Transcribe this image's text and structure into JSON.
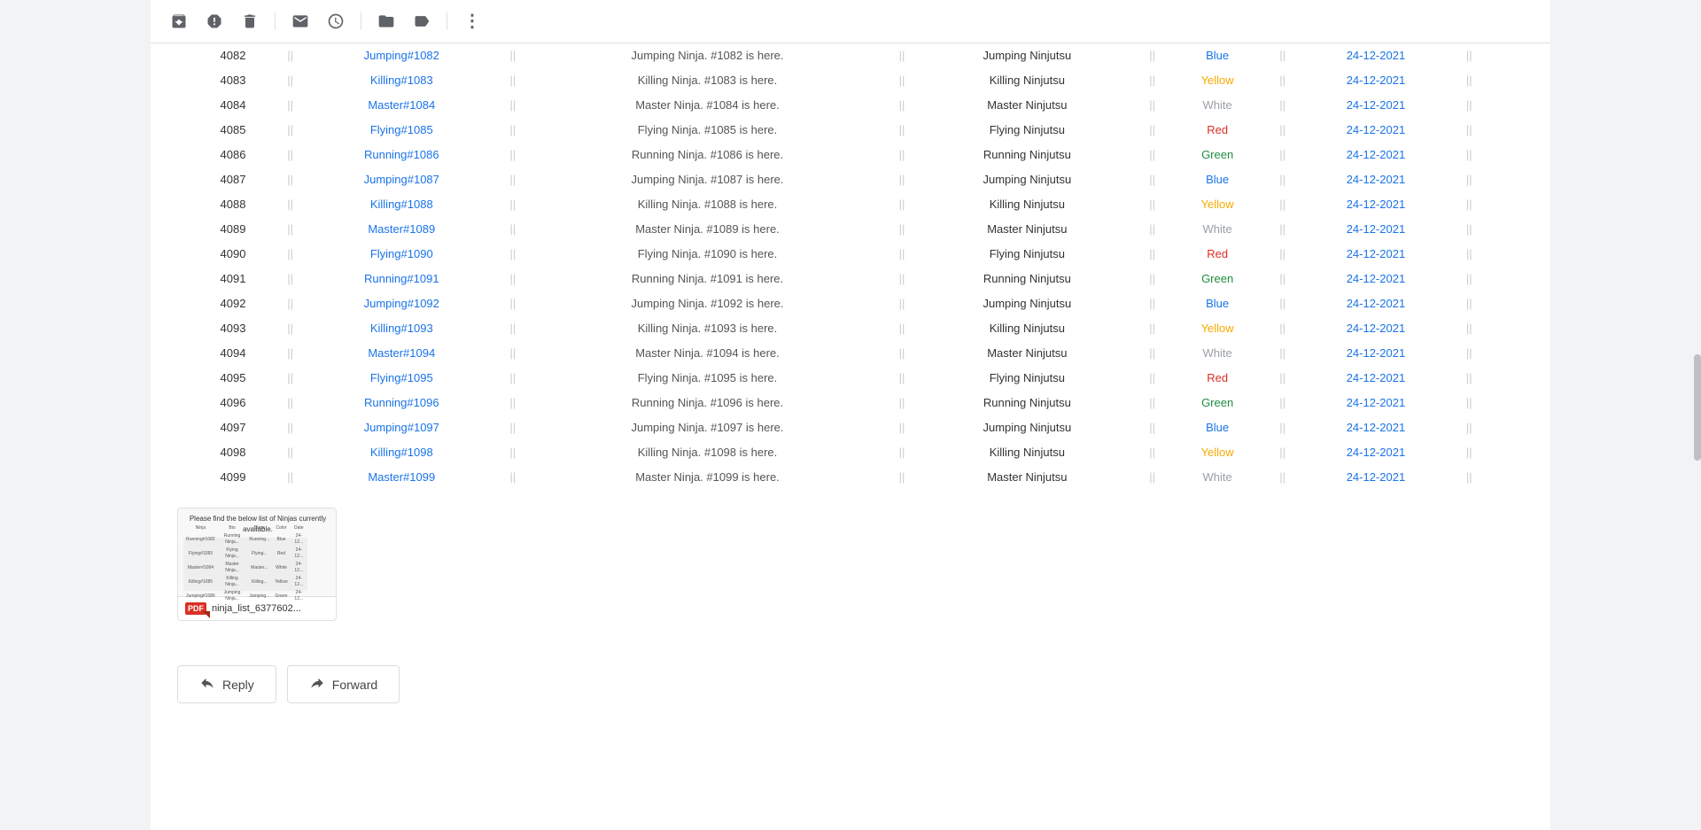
{
  "toolbar": {
    "icons": [
      {
        "name": "archive-icon",
        "symbol": "⬇",
        "interactable": true
      },
      {
        "name": "report-icon",
        "symbol": "⚠",
        "interactable": true
      },
      {
        "name": "delete-icon",
        "symbol": "🗑",
        "interactable": true
      },
      {
        "name": "email-icon",
        "symbol": "✉",
        "interactable": true
      },
      {
        "name": "clock-icon",
        "symbol": "🕐",
        "interactable": true
      },
      {
        "name": "bookmark-icon",
        "symbol": "⬛",
        "interactable": true
      },
      {
        "name": "label-icon",
        "symbol": "🏷",
        "interactable": true
      },
      {
        "name": "more-icon",
        "symbol": "⋮",
        "interactable": true
      }
    ]
  },
  "table": {
    "rows": [
      {
        "id": "4082",
        "name": "Jumping#1082",
        "desc": "Jumping Ninja. #1082 is here.",
        "class": "Jumping Ninjutsu",
        "color": "Blue",
        "date": "24-12-2021"
      },
      {
        "id": "4083",
        "name": "Killing#1083",
        "desc": "Killing Ninja. #1083 is here.",
        "class": "Killing Ninjutsu",
        "color": "Yellow",
        "date": "24-12-2021"
      },
      {
        "id": "4084",
        "name": "Master#1084",
        "desc": "Master Ninja. #1084 is here.",
        "class": "Master Ninjutsu",
        "color": "White",
        "date": "24-12-2021"
      },
      {
        "id": "4085",
        "name": "Flying#1085",
        "desc": "Flying Ninja. #1085 is here.",
        "class": "Flying Ninjutsu",
        "color": "Red",
        "date": "24-12-2021"
      },
      {
        "id": "4086",
        "name": "Running#1086",
        "desc": "Running Ninja. #1086 is here.",
        "class": "Running Ninjutsu",
        "color": "Green",
        "date": "24-12-2021"
      },
      {
        "id": "4087",
        "name": "Jumping#1087",
        "desc": "Jumping Ninja. #1087 is here.",
        "class": "Jumping Ninjutsu",
        "color": "Blue",
        "date": "24-12-2021"
      },
      {
        "id": "4088",
        "name": "Killing#1088",
        "desc": "Killing Ninja. #1088 is here.",
        "class": "Killing Ninjutsu",
        "color": "Yellow",
        "date": "24-12-2021"
      },
      {
        "id": "4089",
        "name": "Master#1089",
        "desc": "Master Ninja. #1089 is here.",
        "class": "Master Ninjutsu",
        "color": "White",
        "date": "24-12-2021"
      },
      {
        "id": "4090",
        "name": "Flying#1090",
        "desc": "Flying Ninja. #1090 is here.",
        "class": "Flying Ninjutsu",
        "color": "Red",
        "date": "24-12-2021"
      },
      {
        "id": "4091",
        "name": "Running#1091",
        "desc": "Running Ninja. #1091 is here.",
        "class": "Running Ninjutsu",
        "color": "Green",
        "date": "24-12-2021"
      },
      {
        "id": "4092",
        "name": "Jumping#1092",
        "desc": "Jumping Ninja. #1092 is here.",
        "class": "Jumping Ninjutsu",
        "color": "Blue",
        "date": "24-12-2021"
      },
      {
        "id": "4093",
        "name": "Killing#1093",
        "desc": "Killing Ninja. #1093 is here.",
        "class": "Killing Ninjutsu",
        "color": "Yellow",
        "date": "24-12-2021"
      },
      {
        "id": "4094",
        "name": "Master#1094",
        "desc": "Master Ninja. #1094 is here.",
        "class": "Master Ninjutsu",
        "color": "White",
        "date": "24-12-2021"
      },
      {
        "id": "4095",
        "name": "Flying#1095",
        "desc": "Flying Ninja. #1095 is here.",
        "class": "Flying Ninjutsu",
        "color": "Red",
        "date": "24-12-2021"
      },
      {
        "id": "4096",
        "name": "Running#1096",
        "desc": "Running Ninja. #1096 is here.",
        "class": "Running Ninjutsu",
        "color": "Green",
        "date": "24-12-2021"
      },
      {
        "id": "4097",
        "name": "Jumping#1097",
        "desc": "Jumping Ninja. #1097 is here.",
        "class": "Jumping Ninjutsu",
        "color": "Blue",
        "date": "24-12-2021"
      },
      {
        "id": "4098",
        "name": "Killing#1098",
        "desc": "Killing Ninja. #1098 is here.",
        "class": "Killing Ninjutsu",
        "color": "Yellow",
        "date": "24-12-2021"
      },
      {
        "id": "4099",
        "name": "Master#1099",
        "desc": "Master Ninja. #1099 is here.",
        "class": "Master Ninjutsu",
        "color": "White",
        "date": "24-12-2021"
      }
    ]
  },
  "attachment": {
    "preview_text": "Please find the below list of Ninjas currently available.",
    "filename": "ninja_list_6377602...",
    "pdf_label": "PDF"
  },
  "actions": {
    "reply_label": "Reply",
    "forward_label": "Forward",
    "reply_icon": "↩",
    "forward_icon": "↪"
  },
  "colors": {
    "blue": "#1a73e8",
    "yellow": "#f9ab00",
    "white": "#9aa0a6",
    "red": "#d93025",
    "green": "#1e8e3e"
  }
}
